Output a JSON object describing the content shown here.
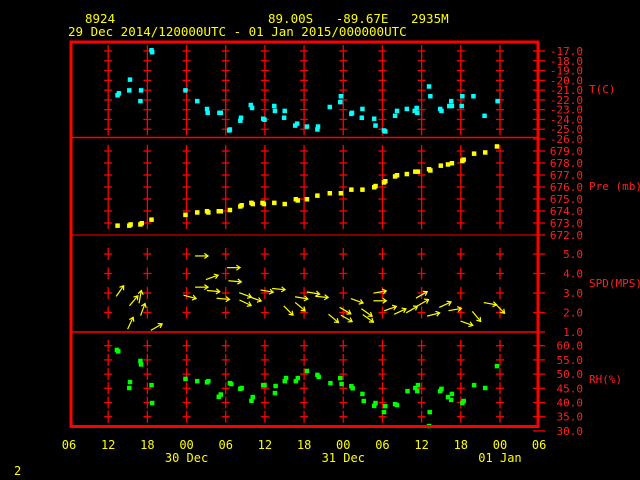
{
  "header": {
    "station": "8924",
    "location": "89.00S   -89.67E   2935M",
    "period": "29 Dec 2014/120000UTC - 01 Jan 2015/000000UTC"
  },
  "footer": {
    "page": "2"
  },
  "colors": {
    "frame": "#ff0000",
    "text": "#ffff00",
    "temperature": "#00ffff",
    "pressure": "#ffff00",
    "wind": "#ffff00",
    "rh": "#00ff00"
  },
  "x_axis": {
    "unit": "hours since 29 Dec 2014 06 UTC",
    "xlim": [
      0,
      72
    ],
    "tick_labels": [
      "06",
      "12",
      "18",
      "00",
      "06",
      "12",
      "18",
      "00",
      "06",
      "12",
      "18",
      "00",
      "06"
    ],
    "day_labels": [
      {
        "label": "30 Dec",
        "hour": 18
      },
      {
        "label": "31 Dec",
        "hour": 42
      },
      {
        "label": "01 Jan",
        "hour": 66
      }
    ]
  },
  "chart_data": [
    {
      "type": "scatter",
      "name": "temperature",
      "ylabel": "T(C)",
      "ylim": [
        -26,
        -16.0
      ],
      "tick_values": [
        -17,
        -18,
        -19,
        -20,
        -21,
        -22,
        -23,
        -24,
        -25,
        -26
      ],
      "tick_labels": [
        "-17.0",
        "-18.0",
        "-19.0",
        "-20.0",
        "-21.0",
        "-22.0",
        "-23.0",
        "-24.0",
        "-25.0",
        "-26.0"
      ],
      "points": [
        [
          7.4,
          -21.5
        ],
        [
          7.6,
          -21.3
        ],
        [
          9.3,
          -19.9
        ],
        [
          9.2,
          -21.0
        ],
        [
          11.0,
          -21.0
        ],
        [
          10.9,
          -22.1
        ],
        [
          12.6,
          -16.9
        ],
        [
          12.7,
          -17.1
        ],
        [
          17.8,
          -21.0
        ],
        [
          19.6,
          -22.1
        ],
        [
          21.1,
          -22.9
        ],
        [
          21.2,
          -23.3
        ],
        [
          23.0,
          -23.3
        ],
        [
          23.2,
          -23.3
        ],
        [
          24.6,
          -25.0
        ],
        [
          24.5,
          -25.1
        ],
        [
          26.2,
          -24.1
        ],
        [
          26.3,
          -23.8
        ],
        [
          27.8,
          -22.5
        ],
        [
          28.0,
          -22.8
        ],
        [
          29.7,
          -23.9
        ],
        [
          29.9,
          -24.0
        ],
        [
          31.4,
          -22.6
        ],
        [
          31.5,
          -23.1
        ],
        [
          33.0,
          -23.1
        ],
        [
          32.9,
          -23.8
        ],
        [
          34.6,
          -24.6
        ],
        [
          34.9,
          -24.4
        ],
        [
          36.4,
          -24.7
        ],
        [
          38.1,
          -24.7
        ],
        [
          38.0,
          -25.0
        ],
        [
          39.9,
          -22.7
        ],
        [
          41.6,
          -21.6
        ],
        [
          41.5,
          -22.2
        ],
        [
          43.2,
          -23.4
        ],
        [
          43.3,
          -23.3
        ],
        [
          44.9,
          -22.9
        ],
        [
          44.8,
          -23.8
        ],
        [
          46.7,
          -23.9
        ],
        [
          46.9,
          -24.6
        ],
        [
          48.2,
          -25.1
        ],
        [
          48.4,
          -25.2
        ],
        [
          49.9,
          -23.6
        ],
        [
          50.2,
          -23.1
        ],
        [
          51.7,
          -22.9
        ],
        [
          52.9,
          -23.1
        ],
        [
          53.2,
          -22.8
        ],
        [
          53.3,
          -23.3
        ],
        [
          55.1,
          -20.6
        ],
        [
          55.3,
          -21.6
        ],
        [
          56.8,
          -22.9
        ],
        [
          57.0,
          -23.1
        ],
        [
          58.2,
          -22.6
        ],
        [
          58.6,
          -22.6
        ],
        [
          58.5,
          -22.1
        ],
        [
          60.2,
          -21.6
        ],
        [
          60.1,
          -22.6
        ],
        [
          61.9,
          -21.6
        ],
        [
          63.6,
          -23.6
        ],
        [
          65.6,
          -22.1
        ]
      ]
    },
    {
      "type": "scatter",
      "name": "pressure",
      "ylabel": "Pre (mb)",
      "ylim": [
        672,
        679.8
      ],
      "tick_values": [
        679,
        678,
        677,
        676,
        675,
        674,
        673,
        672
      ],
      "tick_labels": [
        "679.0",
        "678.0",
        "677.0",
        "676.0",
        "675.0",
        "674.0",
        "673.0",
        "672.0"
      ],
      "points": [
        [
          7.4,
          672.8
        ],
        [
          9.2,
          672.8
        ],
        [
          9.4,
          672.9
        ],
        [
          10.9,
          672.9
        ],
        [
          11.1,
          673.0
        ],
        [
          12.6,
          673.3
        ],
        [
          17.8,
          673.7
        ],
        [
          19.6,
          673.9
        ],
        [
          21.1,
          674.0
        ],
        [
          21.3,
          673.9
        ],
        [
          22.9,
          674.0
        ],
        [
          23.2,
          674.0
        ],
        [
          24.6,
          674.1
        ],
        [
          26.2,
          674.4
        ],
        [
          26.4,
          674.5
        ],
        [
          27.9,
          674.7
        ],
        [
          28.1,
          674.6
        ],
        [
          29.6,
          674.7
        ],
        [
          29.8,
          674.6
        ],
        [
          31.4,
          674.7
        ],
        [
          33.0,
          674.6
        ],
        [
          34.7,
          675.0
        ],
        [
          35.0,
          674.9
        ],
        [
          36.4,
          675.0
        ],
        [
          38.0,
          675.3
        ],
        [
          39.9,
          675.5
        ],
        [
          41.6,
          675.5
        ],
        [
          43.2,
          675.8
        ],
        [
          44.9,
          675.8
        ],
        [
          46.7,
          676.0
        ],
        [
          46.9,
          676.1
        ],
        [
          48.2,
          676.4
        ],
        [
          48.4,
          676.5
        ],
        [
          49.9,
          676.9
        ],
        [
          50.2,
          677.0
        ],
        [
          51.7,
          677.1
        ],
        [
          53.0,
          677.3
        ],
        [
          53.4,
          677.3
        ],
        [
          55.1,
          677.5
        ],
        [
          55.3,
          677.4
        ],
        [
          56.9,
          677.8
        ],
        [
          58.0,
          677.9
        ],
        [
          58.6,
          678.0
        ],
        [
          60.2,
          678.2
        ],
        [
          60.4,
          678.3
        ],
        [
          62.0,
          678.8
        ],
        [
          63.7,
          678.9
        ],
        [
          65.5,
          679.4
        ]
      ]
    },
    {
      "type": "vector",
      "name": "wind",
      "ylabel": "SPD(MPS)",
      "ylim": [
        1,
        5.5
      ],
      "tick_values": [
        5,
        4,
        3,
        2,
        1
      ],
      "tick_labels": [
        "5.0",
        "4.0",
        "3.0",
        "2.0",
        "1.0"
      ],
      "points_note": "[hour, speed, arrow angle deg (0 = pointing right, +90 = up)]",
      "points": [
        [
          7.8,
          3.1,
          55
        ],
        [
          9.4,
          1.45,
          65
        ],
        [
          9.9,
          2.6,
          50
        ],
        [
          10.9,
          2.8,
          80
        ],
        [
          11.3,
          2.15,
          70
        ],
        [
          13.4,
          1.25,
          30
        ],
        [
          20.3,
          4.9,
          0
        ],
        [
          18.5,
          2.8,
          -15
        ],
        [
          20.3,
          3.3,
          0
        ],
        [
          21.9,
          3.8,
          20
        ],
        [
          22.1,
          3.1,
          -5
        ],
        [
          23.6,
          2.7,
          -5
        ],
        [
          25.2,
          4.3,
          0
        ],
        [
          25.4,
          3.6,
          -5
        ],
        [
          27.0,
          2.9,
          -20
        ],
        [
          27.0,
          2.5,
          -25
        ],
        [
          28.5,
          2.7,
          -20
        ],
        [
          30.3,
          3.1,
          -10
        ],
        [
          32.1,
          3.2,
          -5
        ],
        [
          33.6,
          2.1,
          -45
        ],
        [
          35.4,
          2.3,
          -40
        ],
        [
          35.6,
          2.75,
          -10
        ],
        [
          37.4,
          3.0,
          -10
        ],
        [
          38.7,
          2.8,
          -5
        ],
        [
          40.5,
          1.7,
          -40
        ],
        [
          42.3,
          2.1,
          -30
        ],
        [
          42.5,
          1.7,
          -30
        ],
        [
          44.1,
          2.6,
          -20
        ],
        [
          45.6,
          2.0,
          -35
        ],
        [
          45.8,
          1.7,
          -35
        ],
        [
          47.6,
          3.05,
          10
        ],
        [
          47.6,
          2.6,
          0
        ],
        [
          49.2,
          2.2,
          20
        ],
        [
          50.7,
          2.05,
          25
        ],
        [
          52.5,
          2.15,
          30
        ],
        [
          54.0,
          2.9,
          30
        ],
        [
          54.2,
          2.5,
          30
        ],
        [
          55.8,
          1.9,
          15
        ],
        [
          57.6,
          2.4,
          25
        ],
        [
          59.1,
          2.15,
          10
        ],
        [
          60.9,
          1.45,
          -20
        ],
        [
          62.4,
          1.8,
          -50
        ],
        [
          64.5,
          2.45,
          -10
        ],
        [
          66.0,
          2.2,
          -45
        ]
      ]
    },
    {
      "type": "scatter",
      "name": "relative_humidity",
      "ylabel": "RH(%)",
      "ylim": [
        30,
        61
      ],
      "tick_values": [
        60,
        55,
        50,
        45,
        40,
        35,
        30
      ],
      "tick_labels": [
        "60.0",
        "55.0",
        "50.0",
        "45.0",
        "40.0",
        "35.0",
        "30.0"
      ],
      "points": [
        [
          7.3,
          58.6
        ],
        [
          7.5,
          58.1
        ],
        [
          9.3,
          47.3
        ],
        [
          9.2,
          45.2
        ],
        [
          10.9,
          54.7
        ],
        [
          11.0,
          53.5
        ],
        [
          12.6,
          46.2
        ],
        [
          12.7,
          39.9
        ],
        [
          17.8,
          48.4
        ],
        [
          19.6,
          47.6
        ],
        [
          21.1,
          47.2
        ],
        [
          21.3,
          47.6
        ],
        [
          22.9,
          42.1
        ],
        [
          23.2,
          42.9
        ],
        [
          24.6,
          46.9
        ],
        [
          24.8,
          46.6
        ],
        [
          26.2,
          44.9
        ],
        [
          26.4,
          45.2
        ],
        [
          27.9,
          40.7
        ],
        [
          28.1,
          42.0
        ],
        [
          29.7,
          46.2
        ],
        [
          29.9,
          46.2
        ],
        [
          31.5,
          43.4
        ],
        [
          31.6,
          45.9
        ],
        [
          33.0,
          47.6
        ],
        [
          33.2,
          48.7
        ],
        [
          34.7,
          47.6
        ],
        [
          35.0,
          48.7
        ],
        [
          36.4,
          51.2
        ],
        [
          38.0,
          49.8
        ],
        [
          38.2,
          49.1
        ],
        [
          40.0,
          46.9
        ],
        [
          41.5,
          48.7
        ],
        [
          41.7,
          46.6
        ],
        [
          43.2,
          45.8
        ],
        [
          43.4,
          45.1
        ],
        [
          44.9,
          43.1
        ],
        [
          45.1,
          40.6
        ],
        [
          46.7,
          38.9
        ],
        [
          46.9,
          39.9
        ],
        [
          48.2,
          36.7
        ],
        [
          48.4,
          38.8
        ],
        [
          49.9,
          39.5
        ],
        [
          50.2,
          39.2
        ],
        [
          51.8,
          44.1
        ],
        [
          53.0,
          45.2
        ],
        [
          53.4,
          46.2
        ],
        [
          53.3,
          44.1
        ],
        [
          55.2,
          36.7
        ],
        [
          55.1,
          31.8
        ],
        [
          56.8,
          44.1
        ],
        [
          57.0,
          44.9
        ],
        [
          58.0,
          42.0
        ],
        [
          58.5,
          41.0
        ],
        [
          58.6,
          43.1
        ],
        [
          60.2,
          39.9
        ],
        [
          60.4,
          40.6
        ],
        [
          62.0,
          46.2
        ],
        [
          63.7,
          45.2
        ],
        [
          65.5,
          52.9
        ]
      ]
    }
  ]
}
